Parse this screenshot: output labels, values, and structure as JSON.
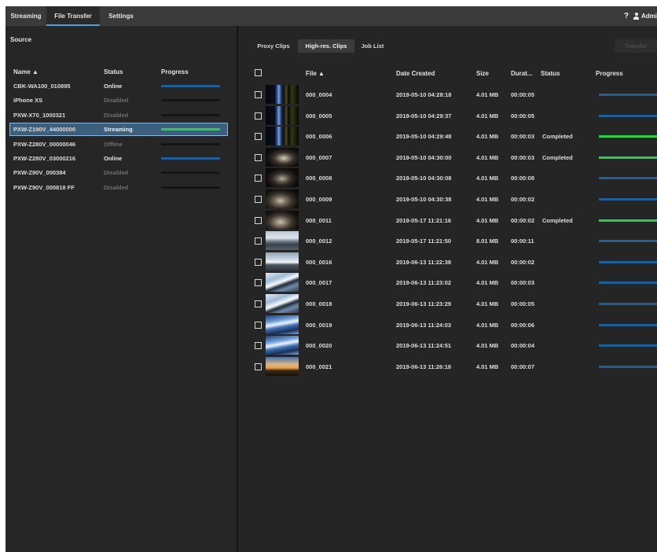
{
  "nav": {
    "tabs": [
      {
        "label": "Streaming"
      },
      {
        "label": "File Transfer"
      },
      {
        "label": "Settings"
      }
    ],
    "help_label": "?",
    "user_label": "Admi"
  },
  "source": {
    "title": "Source",
    "headers": {
      "name": "Name ▲",
      "status": "Status",
      "progress": "Progress"
    },
    "devices": [
      {
        "name": "CBK-WA100_010895",
        "status": "Online",
        "progress": 0
      },
      {
        "name": "iPhone XS",
        "status": "Disabled",
        "progress": 0
      },
      {
        "name": "PXW-X70_1000321",
        "status": "Disabled",
        "progress": 0
      },
      {
        "name": "PXW-Z190V_44000000",
        "status": "Streaming",
        "progress": 100
      },
      {
        "name": "PXW-Z280V_00000046",
        "status": "Offline",
        "progress": 0
      },
      {
        "name": "PXW-Z280V_03000216",
        "status": "Online",
        "progress": 0
      },
      {
        "name": "PXW-Z90V_000384",
        "status": "Disabled",
        "progress": 0
      },
      {
        "name": "PXW-Z90V_000818 FF",
        "status": "Disabled",
        "progress": 0
      }
    ]
  },
  "clips": {
    "tabs": [
      {
        "label": "Proxy Clips"
      },
      {
        "label": "High-res. Clips"
      },
      {
        "label": "Job List"
      }
    ],
    "transfer_label": "Transfer",
    "headers": {
      "file": "File ▲",
      "date": "Date Created",
      "size": "Size",
      "duration": "Durat...",
      "status": "Status",
      "progress": "Progress"
    },
    "rows": [
      {
        "file": "000_0004",
        "date": "2019-05-10 04:28:18",
        "size": "4.01 MB",
        "duration": "00:00:05",
        "status": "",
        "progress": 0
      },
      {
        "file": "000_0005",
        "date": "2019-05-10 04:29:37",
        "size": "4.01 MB",
        "duration": "00:00:05",
        "status": "",
        "progress": 0
      },
      {
        "file": "000_0006",
        "date": "2019-05-10 04:29:48",
        "size": "4.01 MB",
        "duration": "00:00:03",
        "status": "Completed",
        "progress": 100
      },
      {
        "file": "000_0007",
        "date": "2019-05-10 04:30:00",
        "size": "4.01 MB",
        "duration": "00:00:03",
        "status": "Completed",
        "progress": 100
      },
      {
        "file": "000_0008",
        "date": "2019-05-10 04:30:08",
        "size": "4.01 MB",
        "duration": "00:00:08",
        "status": "",
        "progress": 0
      },
      {
        "file": "000_0009",
        "date": "2019-05-10 04:30:38",
        "size": "4.01 MB",
        "duration": "00:00:02",
        "status": "",
        "progress": 0
      },
      {
        "file": "000_0011",
        "date": "2019-05-17 11:21:16",
        "size": "4.01 MB",
        "duration": "00:00:02",
        "status": "Completed",
        "progress": 100
      },
      {
        "file": "000_0012",
        "date": "2019-05-17 11:21:50",
        "size": "8.01 MB",
        "duration": "00:00:11",
        "status": "",
        "progress": 0
      },
      {
        "file": "000_0016",
        "date": "2019-06-13 11:22:38",
        "size": "4.01 MB",
        "duration": "00:00:02",
        "status": "",
        "progress": 0
      },
      {
        "file": "000_0017",
        "date": "2019-06-13 11:23:02",
        "size": "4.01 MB",
        "duration": "00:00:03",
        "status": "",
        "progress": 0
      },
      {
        "file": "000_0018",
        "date": "2019-06-13 11:23:29",
        "size": "4.01 MB",
        "duration": "00:00:05",
        "status": "",
        "progress": 0
      },
      {
        "file": "000_0019",
        "date": "2019-06-13 11:24:03",
        "size": "4.01 MB",
        "duration": "00:00:06",
        "status": "",
        "progress": 0
      },
      {
        "file": "000_0020",
        "date": "2019-06-13 11:24:51",
        "size": "4.01 MB",
        "duration": "00:00:04",
        "status": "",
        "progress": 0
      },
      {
        "file": "000_0021",
        "date": "2019-06-13 11:26:18",
        "size": "4.01 MB",
        "duration": "00:00:07",
        "status": "",
        "progress": 0
      }
    ]
  },
  "colors": {
    "accent_tab": "#4aa3e6",
    "progress_complete": "#25d24a",
    "progress_idle": "#1f5f99",
    "selection": "#3d5f7e"
  }
}
